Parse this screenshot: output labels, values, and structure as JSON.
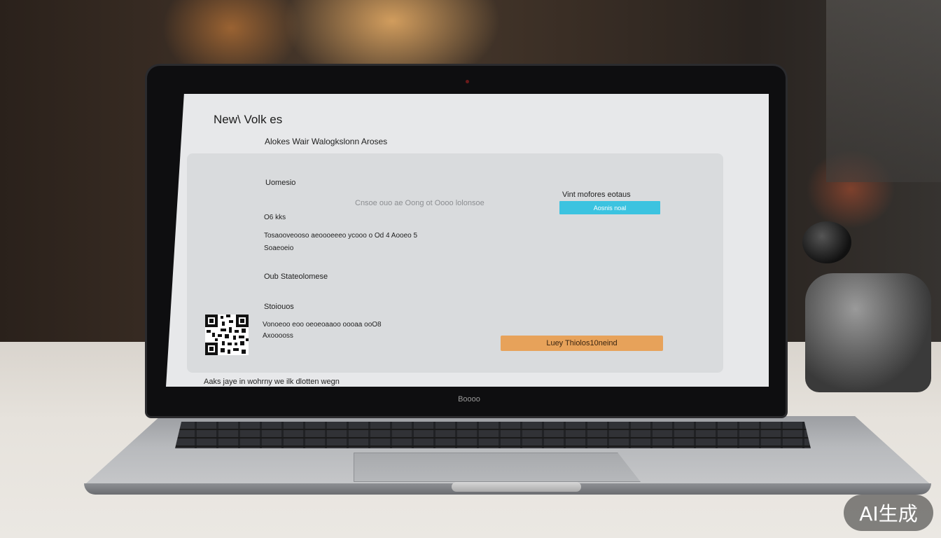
{
  "screen": {
    "title": "New\\ Volk es",
    "subtitle": "Alokes Wair Walogkslonn Aroses",
    "card": {
      "section1_heading": "Uomesio",
      "faded_line": "Cnsoe ouo ae Oong ot Oooo lolonsoe",
      "right_label": "Vint mofores eotaus",
      "blue_button": "Aosnis noal",
      "line_a": "O6 kks",
      "line_b": "Tosaooveooso aeoooeeeo ycooo o Od 4 Aooeo 5",
      "line_c": "Soaeoeio",
      "section2_heading": "Oub Stateolomese",
      "section3_heading": "Stoiouos",
      "line_d": "Vonoeoo eoo oeoeoaaoo oooaa ooO8",
      "line_e": "Axooooss",
      "orange_button": "Luey Thiolos10neind"
    },
    "footer": "Aaks jaye in wohrny we ilk dlotten wegn"
  },
  "laptop": {
    "brand_label": "Boooo"
  },
  "watermark": "AI生成",
  "colors": {
    "accent_blue": "#3cc3e0",
    "accent_orange": "#e7a25a",
    "screen_bg": "#e7e8ea",
    "card_bg": "#d9dbdd"
  }
}
